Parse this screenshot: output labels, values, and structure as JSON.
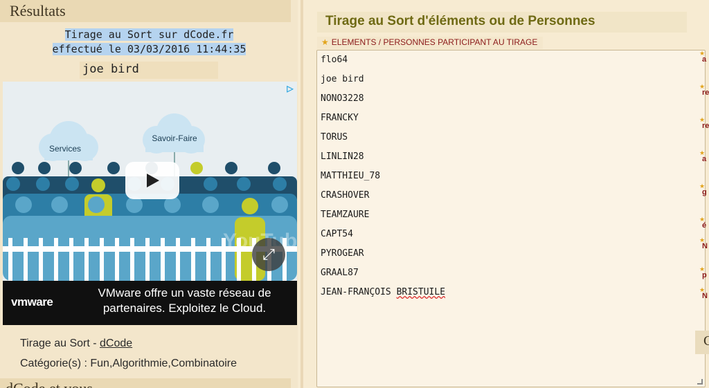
{
  "results": {
    "header": "Résultats",
    "line1": "Tirage au Sort sur dCode.fr",
    "line2": "effectué le 03/03/2016 11:44:35",
    "winner": "joe bird"
  },
  "ad": {
    "bubble_left": "Services",
    "bubble_right": "Savoir-Faire",
    "brand": "vmware",
    "text": "VMware offre un vaste réseau de partenaires. Exploitez le Cloud.",
    "watermark": "YouTube",
    "colors": {
      "dark": "#1f4e6a",
      "mid": "#2d7ea6",
      "light": "#5aa6c9",
      "accent": "#c4cc2b",
      "bubble": "#cbe4f2"
    }
  },
  "info": {
    "prefix": "Tirage au Sort - ",
    "link": "dCode",
    "categories": "Catégorie(s) : Fun,Algorithmie,Combinatoire"
  },
  "dcode_header": "dCode et vous",
  "main": {
    "title": "Tirage au Sort d'éléments ou de Personnes",
    "field_label": "ELEMENTS / PERSONNES PARTICIPANT AU TIRAGE",
    "entries": [
      "flo64",
      "joe bird",
      "NONO3228",
      "FRANCKY",
      "TORUS",
      "LINLIN28",
      "MATTHIEU_78",
      "CRASHOVER",
      "TEAMZAURE",
      "CAPT54",
      "PYROGEAR",
      "GRAAL87",
      "JEAN-FRANÇOIS BRISTUILE"
    ]
  },
  "sidebar_fragment": [
    "a",
    "re",
    "re",
    "a",
    "g",
    "é",
    "N",
    "p",
    "N"
  ],
  "right_button": "C"
}
